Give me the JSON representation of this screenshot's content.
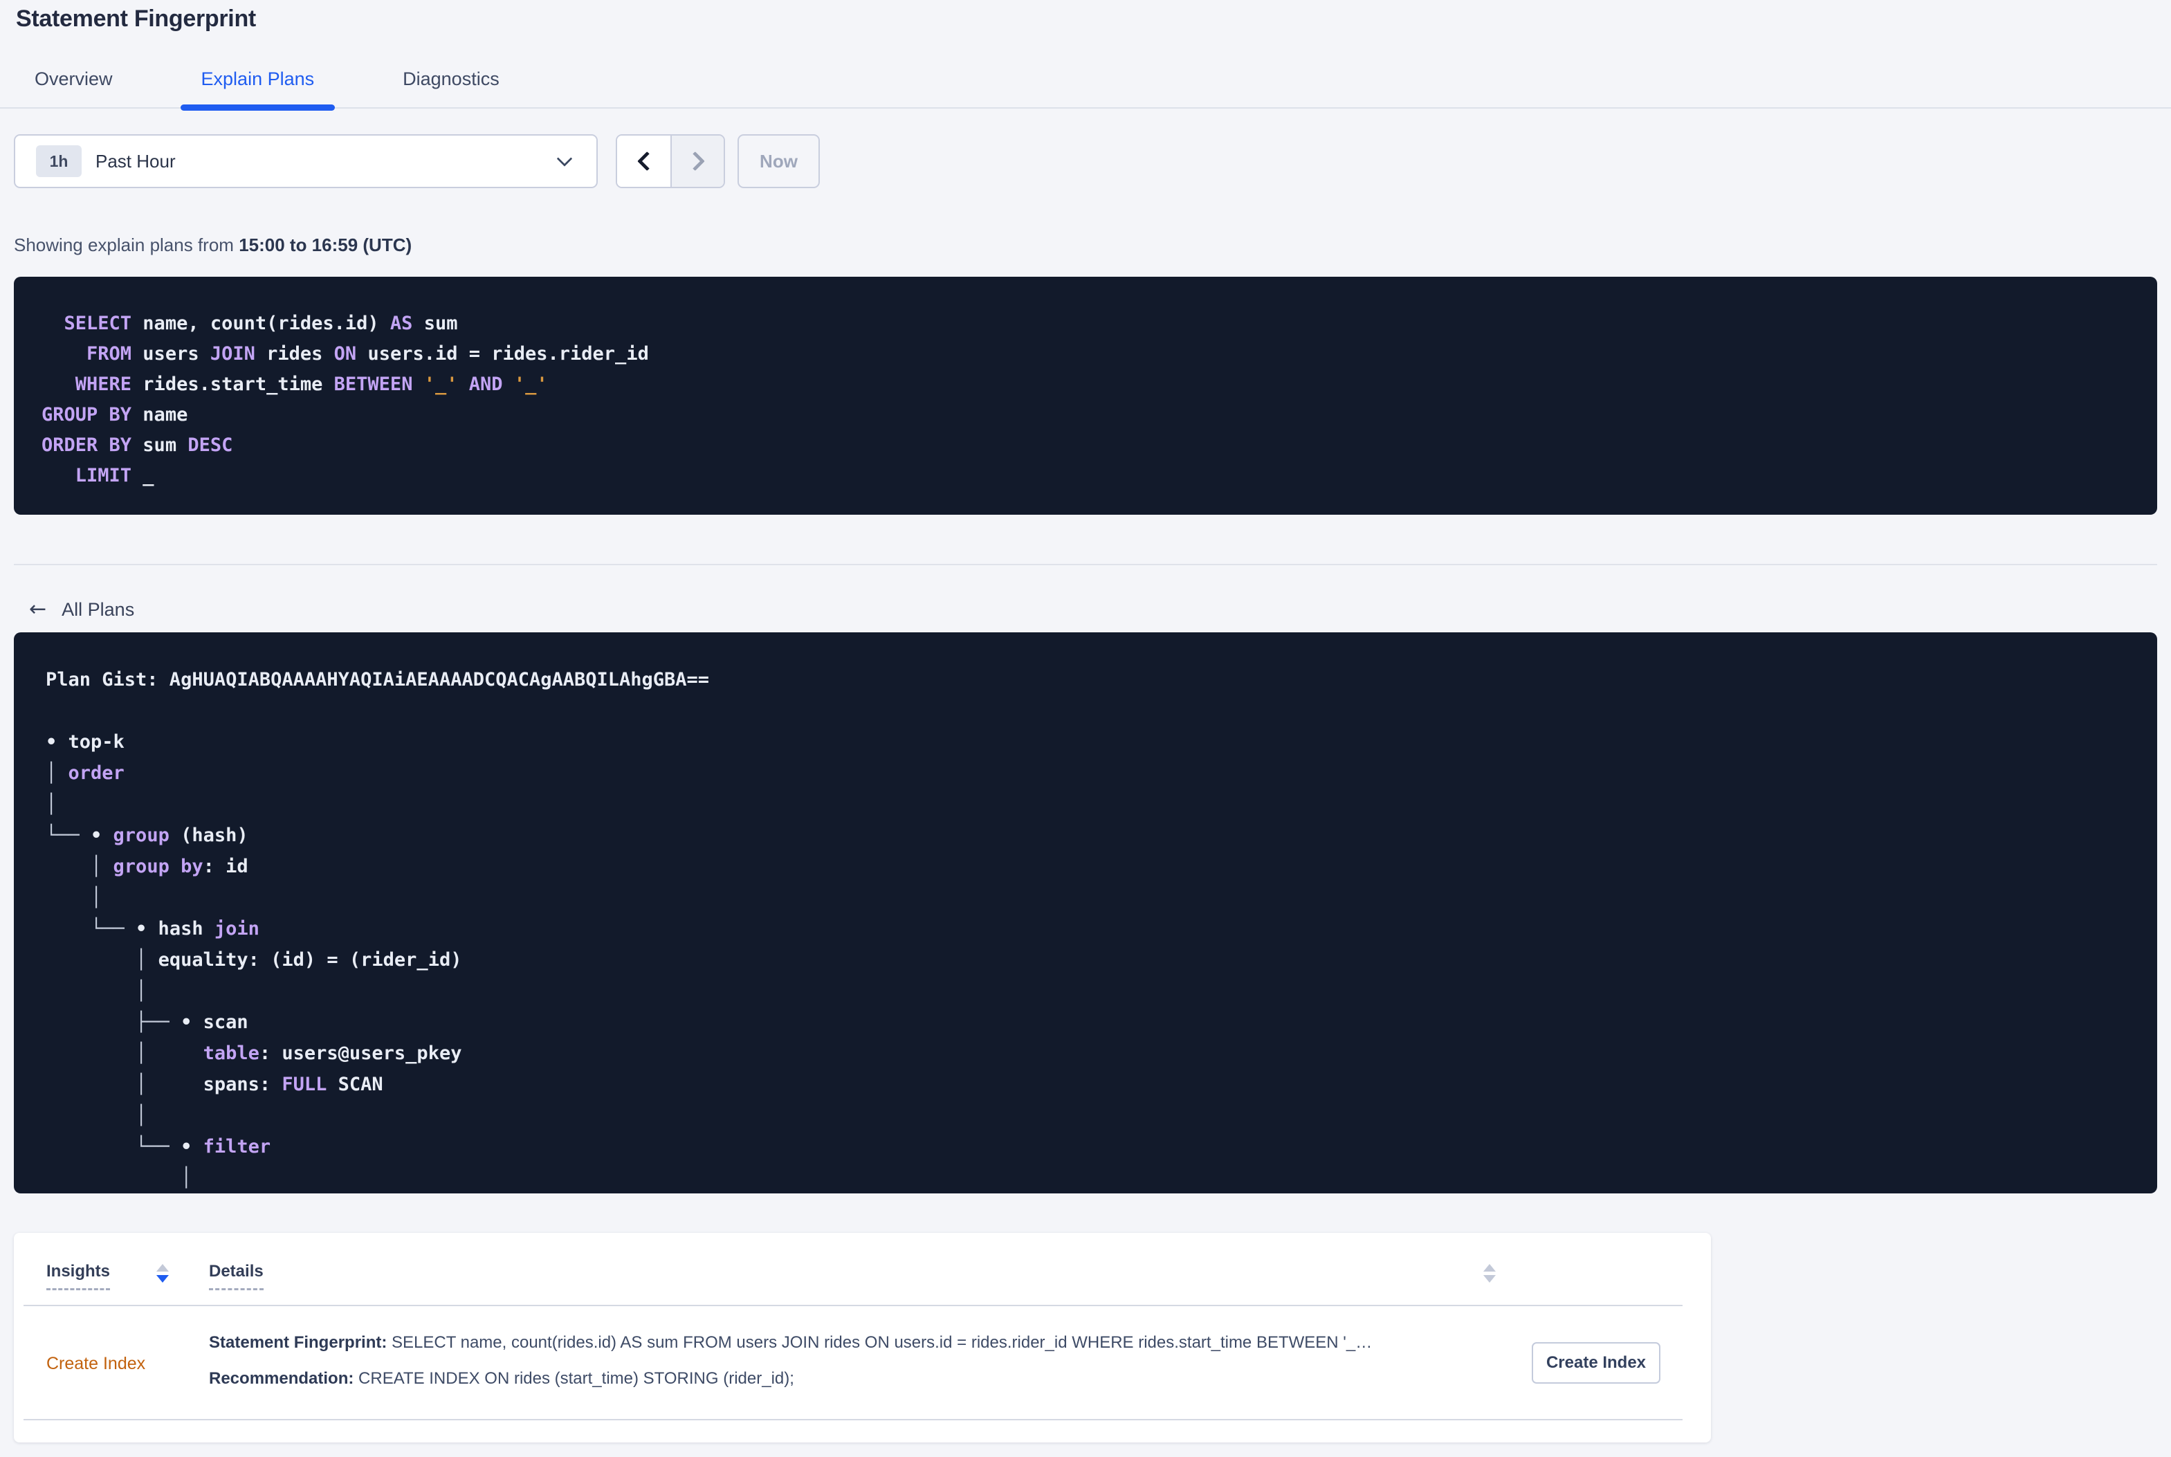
{
  "title": "Statement Fingerprint",
  "tabs": [
    {
      "label": "Overview",
      "active": false
    },
    {
      "label": "Explain Plans",
      "active": true
    },
    {
      "label": "Diagnostics",
      "active": false
    }
  ],
  "time_picker": {
    "range_badge": "1h",
    "range_label": "Past Hour",
    "now_label": "Now",
    "prev_icon": "chevron-left",
    "next_icon": "chevron-right",
    "caret_icon": "chevron-down"
  },
  "summary": {
    "prefix": "Showing explain plans from ",
    "range": "15:00 to 16:59 (UTC)"
  },
  "sql_statement": {
    "lines": [
      [
        {
          "t": "  SELECT",
          "c": "kw"
        },
        {
          "t": " name, count(rides.id) "
        },
        {
          "t": "AS",
          "c": "kw"
        },
        {
          "t": " sum"
        }
      ],
      [
        {
          "t": "    FROM",
          "c": "kw"
        },
        {
          "t": " users "
        },
        {
          "t": "JOIN",
          "c": "kw"
        },
        {
          "t": " rides "
        },
        {
          "t": "ON",
          "c": "kw"
        },
        {
          "t": " users.id = rides.rider_id"
        }
      ],
      [
        {
          "t": "   WHERE",
          "c": "kw"
        },
        {
          "t": " rides.start_time "
        },
        {
          "t": "BETWEEN",
          "c": "kw"
        },
        {
          "t": " "
        },
        {
          "t": "'_'",
          "c": "str"
        },
        {
          "t": " "
        },
        {
          "t": "AND",
          "c": "kw"
        },
        {
          "t": " "
        },
        {
          "t": "'_'",
          "c": "str"
        }
      ],
      [
        {
          "t": "GROUP BY",
          "c": "kw"
        },
        {
          "t": " name"
        }
      ],
      [
        {
          "t": "ORDER BY",
          "c": "kw"
        },
        {
          "t": " sum "
        },
        {
          "t": "DESC",
          "c": "kw"
        }
      ],
      [
        {
          "t": "   LIMIT",
          "c": "kw"
        },
        {
          "t": " _"
        }
      ]
    ]
  },
  "back_link": {
    "icon": "←",
    "label": "All Plans"
  },
  "plan_gist": {
    "lines": [
      [
        {
          "t": "Plan Gist: AgHUAQIABQAAAAHYAQIAiAEAAAADCQACAgAABQILAhgGBA=="
        }
      ],
      [],
      [
        {
          "t": "• top-k"
        }
      ],
      [
        {
          "t": "│ ",
          "c": "ln"
        },
        {
          "t": "order",
          "c": "kw"
        }
      ],
      [
        {
          "t": "│",
          "c": "ln"
        }
      ],
      [
        {
          "t": "└── ",
          "c": "ln"
        },
        {
          "t": "• "
        },
        {
          "t": "group",
          "c": "kw"
        },
        {
          "t": " (hash)"
        }
      ],
      [
        {
          "t": "    │ ",
          "c": "ln"
        },
        {
          "t": "group by",
          "c": "kw"
        },
        {
          "t": ": id"
        }
      ],
      [
        {
          "t": "    │",
          "c": "ln"
        }
      ],
      [
        {
          "t": "    └── ",
          "c": "ln"
        },
        {
          "t": "• hash "
        },
        {
          "t": "join",
          "c": "kw"
        }
      ],
      [
        {
          "t": "        │ ",
          "c": "ln"
        },
        {
          "t": "equality: (id) = (rider_id)"
        }
      ],
      [
        {
          "t": "        │",
          "c": "ln"
        }
      ],
      [
        {
          "t": "        ├── ",
          "c": "ln"
        },
        {
          "t": "• scan"
        }
      ],
      [
        {
          "t": "        │     ",
          "c": "ln"
        },
        {
          "t": "table",
          "c": "kw"
        },
        {
          "t": ": users@users_pkey"
        }
      ],
      [
        {
          "t": "        │     ",
          "c": "ln"
        },
        {
          "t": "spans: "
        },
        {
          "t": "FULL",
          "c": "kw"
        },
        {
          "t": " SCAN"
        }
      ],
      [
        {
          "t": "        │",
          "c": "ln"
        }
      ],
      [
        {
          "t": "        └── ",
          "c": "ln"
        },
        {
          "t": "• "
        },
        {
          "t": "filter",
          "c": "kw"
        }
      ],
      [
        {
          "t": "            │",
          "c": "ln"
        }
      ],
      [
        {
          "t": "            │",
          "c": "ln"
        }
      ]
    ]
  },
  "insights": {
    "columns": [
      {
        "label": "Insights"
      },
      {
        "label": "Details"
      }
    ],
    "rows": [
      {
        "insight_type": "Create Index",
        "fingerprint_label": "Statement Fingerprint:",
        "fingerprint_text": " SELECT name, count(rides.id) AS sum FROM users JOIN rides ON users.id = rides.rider_id WHERE rides.start_time BETWEEN '_…",
        "recommendation_label": "Recommendation:",
        "recommendation_text": " CREATE INDEX ON rides (start_time) STORING (rider_id);",
        "action_label": "Create Index"
      }
    ]
  },
  "colors": {
    "accent_blue": "#1f5cf0",
    "link_orange": "#c2620e",
    "code_background": "#121a2b",
    "code_keyword": "#c3a4f4",
    "code_literal": "#d99840",
    "page_background": "#f4f5f9"
  }
}
